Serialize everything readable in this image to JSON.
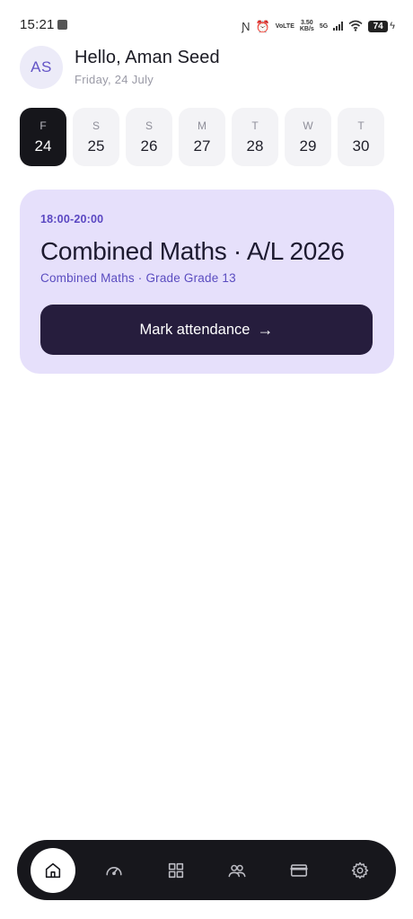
{
  "status_bar": {
    "time": "15:21",
    "network_type": "VoLTE",
    "net_speed": "3.50",
    "net_speed_unit": "KB/s",
    "cell_gen": "5G",
    "battery": "74"
  },
  "header": {
    "avatar_initials": "AS",
    "greeting": "Hello, Aman Seed",
    "date": "Friday, 24 July"
  },
  "days": [
    {
      "weekday": "F",
      "date": "24",
      "active": true
    },
    {
      "weekday": "S",
      "date": "25",
      "active": false
    },
    {
      "weekday": "S",
      "date": "26",
      "active": false
    },
    {
      "weekday": "M",
      "date": "27",
      "active": false
    },
    {
      "weekday": "T",
      "date": "28",
      "active": false
    },
    {
      "weekday": "W",
      "date": "29",
      "active": false
    },
    {
      "weekday": "T",
      "date": "30",
      "active": false
    }
  ],
  "class_card": {
    "time": "18:00-20:00",
    "title": "Combined Maths · A/L 2026",
    "subtitle": "Combined Maths · Grade Grade 13",
    "button_label": "Mark attendance",
    "button_arrow": "→"
  },
  "bottom_nav": {
    "items": [
      {
        "name": "home",
        "icon": "home-icon",
        "active": true
      },
      {
        "name": "dashboard",
        "icon": "speedometer-icon",
        "active": false
      },
      {
        "name": "classes",
        "icon": "grid-icon",
        "active": false
      },
      {
        "name": "students",
        "icon": "users-icon",
        "active": false
      },
      {
        "name": "payments",
        "icon": "card-icon",
        "active": false
      },
      {
        "name": "settings",
        "icon": "gear-icon",
        "active": false
      }
    ]
  },
  "colors": {
    "accent": "#5a47c2",
    "card_bg": "#e6e0fb",
    "button_bg": "#261d3d",
    "nav_bg": "#17171c"
  }
}
